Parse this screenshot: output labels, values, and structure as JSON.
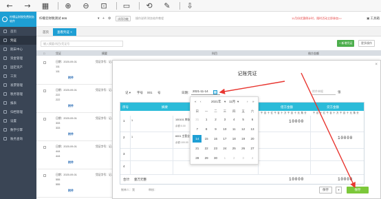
{
  "toolbar": {
    "icons": [
      "arrow-left-icon",
      "arrow-right-icon",
      "grid-icon",
      "zoom-in-icon",
      "zoom-out-icon",
      "fit-icon",
      "window-icon",
      "rotate-icon",
      "edit-icon",
      "export-icon"
    ]
  },
  "header": {
    "logo_text": "柠檬云财税免费财务软件",
    "company": "柠檬云财税测试 666",
    "add_label": "+",
    "feature_btn": "试用功能",
    "help_link": "操作说明 财务软件教程",
    "notice": "11月份优惠倒计时，限时活动立即参加>>",
    "right_label": "工具箱"
  },
  "sidebar": {
    "items": [
      {
        "label": "首页"
      },
      {
        "label": "凭证"
      },
      {
        "label": "期末中心"
      },
      {
        "label": "资金管理"
      },
      {
        "label": "固定资产"
      },
      {
        "label": "工资"
      },
      {
        "label": "发票管理"
      },
      {
        "label": "税务管理"
      },
      {
        "label": "报表"
      },
      {
        "label": "归档管理"
      },
      {
        "label": "设置"
      },
      {
        "label": "数字引擎"
      },
      {
        "label": "账务查询"
      }
    ]
  },
  "tabs": [
    {
      "label": "首页"
    },
    {
      "label": "查看凭证 ×"
    }
  ],
  "list": {
    "search_placeholder": "输入摘要/科目/凭证号",
    "btn_add": "+ 新增凭证",
    "btn_more": "更多操作",
    "headers": [
      "凭证",
      "摘要",
      "科目",
      "借方金额"
    ],
    "rows": [
      {
        "date": "日期：2020-09-01",
        "voucher": "凭证字号：记-001",
        "summary": "111",
        "attach": "附件"
      },
      {
        "date": "日期：2020-09-01",
        "voucher": "凭证字号：记-002",
        "summary": "222",
        "attach": "附件"
      },
      {
        "date": "日期：2020-09-01",
        "voucher": "凭证字号：记-003",
        "summary": "333",
        "attach": "附件"
      },
      {
        "date": "日期：2020-09-01",
        "voucher": "凭证字号：记-004",
        "summary": "444",
        "attach": "附件"
      },
      {
        "date": "日期：2020-09-01",
        "voucher": "凭证字号：记-005",
        "summary": "555",
        "attach": "附件"
      }
    ]
  },
  "modal": {
    "title": "记账凭证",
    "voucher_word_label": "记",
    "voucher_type": "字号",
    "voucher_no": "001",
    "no_suffix": "号",
    "date_label": "日期：",
    "date_value": "2021-11-14",
    "attach_label": "附件单据",
    "attach_unit": "张",
    "close": "×",
    "table_headers": [
      "序号",
      "摘要",
      "会计科目",
      "借方金额",
      "贷方金额"
    ],
    "digit_units": "千 百 十 亿 千 百 十 万 千 百 十 元 角 分",
    "rows": [
      {
        "no": "1",
        "summary": "1",
        "subject": "100101 库存现金",
        "subject_sub": "余额:0.00",
        "debit": "10000",
        "credit": ""
      },
      {
        "no": "2",
        "summary": "1",
        "subject": "6001 主营业务收入",
        "subject_sub": "余额:100.00",
        "debit": "",
        "credit": "10000"
      },
      {
        "no": "3",
        "summary": "",
        "subject": "",
        "subject_sub": "",
        "debit": "",
        "credit": ""
      },
      {
        "no": "4",
        "summary": "",
        "subject": "",
        "subject_sub": "",
        "debit": "",
        "credit": ""
      }
    ],
    "total_label": "合计:",
    "total_text": "壹万元整",
    "total_debit": "10000",
    "total_credit": "10000",
    "maker_label": "制单人：我",
    "reviewer_label": "审核：",
    "btn_save_new": "保存",
    "btn_save": "保存"
  },
  "datepicker": {
    "year": "2021年",
    "month": "11月",
    "weekdays": [
      "日",
      "一",
      "二",
      "三",
      "四",
      "五",
      "六"
    ],
    "weeks": [
      [
        {
          "d": "31",
          "out": true
        },
        {
          "d": "1"
        },
        {
          "d": "2"
        },
        {
          "d": "3"
        },
        {
          "d": "4"
        },
        {
          "d": "5"
        },
        {
          "d": "6"
        }
      ],
      [
        {
          "d": "7"
        },
        {
          "d": "8"
        },
        {
          "d": "9"
        },
        {
          "d": "10"
        },
        {
          "d": "11"
        },
        {
          "d": "12"
        },
        {
          "d": "13"
        }
      ],
      [
        {
          "d": "14",
          "sel": true
        },
        {
          "d": "15"
        },
        {
          "d": "16"
        },
        {
          "d": "17"
        },
        {
          "d": "18"
        },
        {
          "d": "19"
        },
        {
          "d": "20"
        }
      ],
      [
        {
          "d": "21"
        },
        {
          "d": "22"
        },
        {
          "d": "23"
        },
        {
          "d": "24"
        },
        {
          "d": "25"
        },
        {
          "d": "26"
        },
        {
          "d": "27"
        }
      ],
      [
        {
          "d": "28"
        },
        {
          "d": "29"
        },
        {
          "d": "30"
        },
        {
          "d": "1",
          "out": true
        },
        {
          "d": "2",
          "out": true
        },
        {
          "d": "3",
          "out": true
        },
        {
          "d": "4",
          "out": true
        }
      ]
    ]
  },
  "colors": {
    "brand": "#1e9fd4",
    "sidebar": "#3a4555",
    "table_header": "#2bbbd9",
    "save_button": "#7cc83a",
    "arrow": "#e8352f"
  }
}
